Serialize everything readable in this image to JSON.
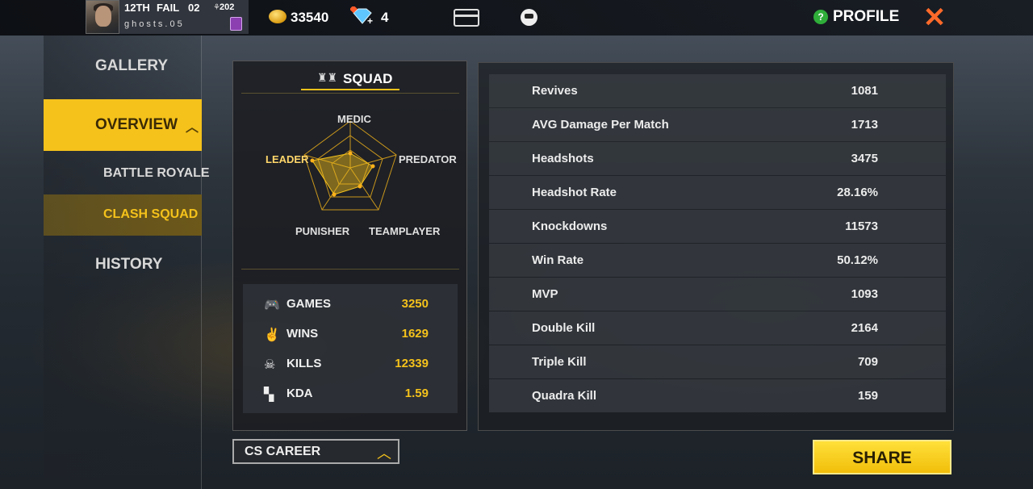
{
  "topbar": {
    "rank": "12TH",
    "status": "FAIL",
    "num": "02",
    "level": "202",
    "player_name": "ghosts.05",
    "coins": "33540",
    "diamonds": "4",
    "profile_label": "PROFILE",
    "help_icon": "?"
  },
  "sidebar": {
    "gallery": "GALLERY",
    "overview": "OVERVIEW",
    "battle_royale": "BATTLE ROYALE",
    "clash_squad": "CLASH SQUAD",
    "history": "HISTORY"
  },
  "squad": {
    "title": "SQUAD",
    "radar_labels": {
      "medic": "MEDIC",
      "leader": "LEADER",
      "predator": "PREDATOR",
      "punisher": "PUNISHER",
      "teamplayer": "TEAMPLAYER"
    },
    "stats": [
      {
        "label": "GAMES",
        "value": "3250",
        "icon": "gamepad-icon"
      },
      {
        "label": "WINS",
        "value": "1629",
        "icon": "victory-hand-icon"
      },
      {
        "label": "KILLS",
        "value": "12339",
        "icon": "skull-icon"
      },
      {
        "label": "KDA",
        "value": "1.59",
        "icon": "pistol-icon"
      }
    ]
  },
  "career_dropdown": "CS CAREER",
  "details": [
    {
      "label": "Revives",
      "value": "1081"
    },
    {
      "label": "AVG Damage Per Match",
      "value": "1713"
    },
    {
      "label": "Headshots",
      "value": "3475"
    },
    {
      "label": "Headshot Rate",
      "value": "28.16%"
    },
    {
      "label": "Knockdowns",
      "value": "11573"
    },
    {
      "label": "Win Rate",
      "value": "50.12%"
    },
    {
      "label": "MVP",
      "value": "1093"
    },
    {
      "label": "Double Kill",
      "value": "2164"
    },
    {
      "label": "Triple Kill",
      "value": "709"
    },
    {
      "label": "Quadra Kill",
      "value": "159"
    }
  ],
  "share_label": "SHARE",
  "colors": {
    "accent": "#f5c21b",
    "close": "#ff6a2a",
    "help": "#2fae3a"
  }
}
